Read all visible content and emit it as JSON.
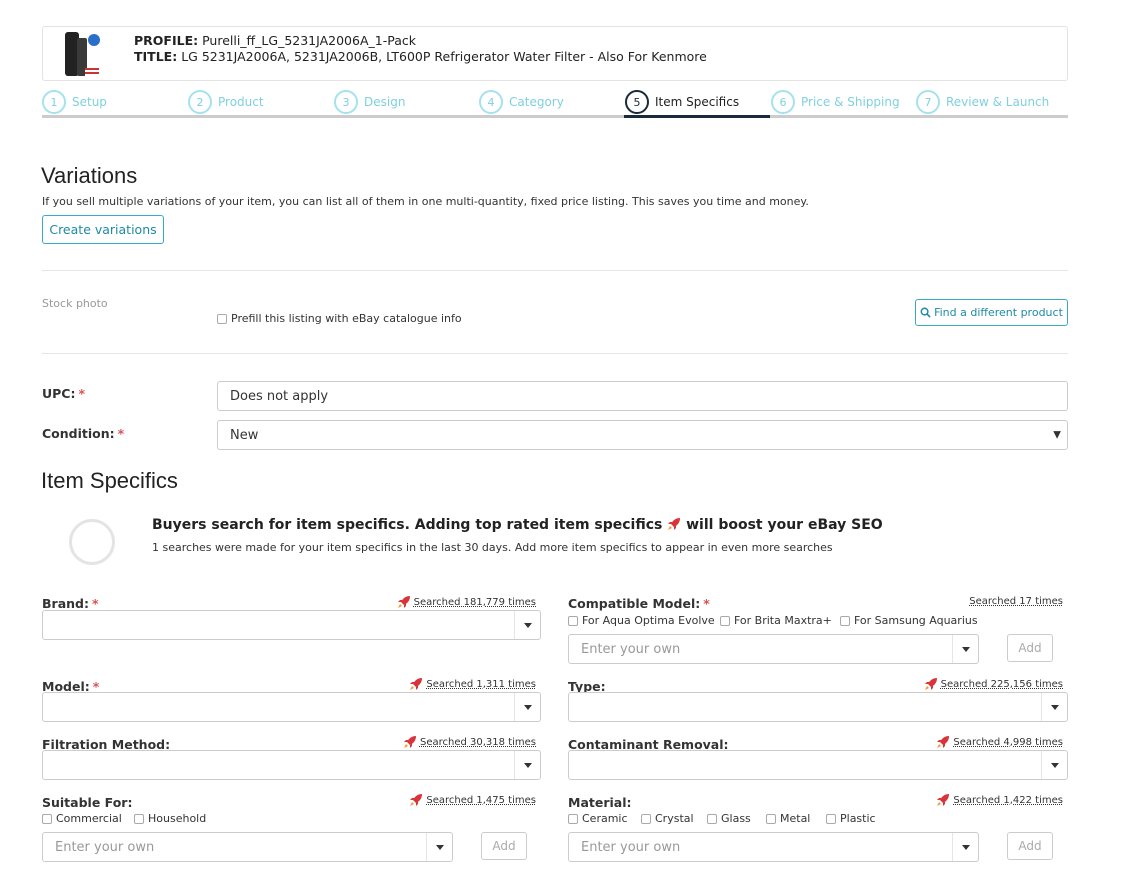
{
  "profile": {
    "profile_label": "PROFILE:",
    "profile_value": "Purelli_ff_LG_5231JA2006A_1-Pack",
    "title_label": "TITLE:",
    "title_value": "LG 5231JA2006A, 5231JA2006B, LT600P Refrigerator Water Filter - Also For Kenmore"
  },
  "steps": [
    {
      "num": "1",
      "label": "Setup"
    },
    {
      "num": "2",
      "label": "Product"
    },
    {
      "num": "3",
      "label": "Design"
    },
    {
      "num": "4",
      "label": "Category"
    },
    {
      "num": "5",
      "label": "Item Specifics",
      "active": true
    },
    {
      "num": "6",
      "label": "Price & Shipping"
    },
    {
      "num": "7",
      "label": "Review & Launch"
    }
  ],
  "variations": {
    "heading": "Variations",
    "description": "If you sell multiple variations of your item, you can list all of them in one multi-quantity, fixed price listing. This saves you time and money.",
    "button": "Create variations"
  },
  "stock": {
    "label": "Stock photo",
    "prefill_label": "Prefill this listing with eBay catalogue info",
    "find_button": "Find a different product"
  },
  "upc": {
    "label": "UPC:",
    "value": "Does not apply"
  },
  "condition": {
    "label": "Condition:",
    "value": "New"
  },
  "specifics": {
    "heading": "Item Specifics",
    "seo_title_a": "Buyers search for item specifics. Adding top rated item specifics",
    "seo_title_b": "will boost your eBay SEO",
    "seo_sub": "1 searches were made for your item specifics in the last 30 days. Add more item specifics to appear in even more searches"
  },
  "fields": {
    "brand": {
      "label": "Brand:",
      "searched": "Searched 181,779 times"
    },
    "compatible_model": {
      "label": "Compatible Model:",
      "searched": "Searched 17 times",
      "options": [
        "For Aqua Optima Evolve",
        "For Brita Maxtra+",
        "For Samsung Aquarius"
      ],
      "placeholder": "Enter your own",
      "add": "Add"
    },
    "model": {
      "label": "Model:",
      "searched": "Searched 1,311 times"
    },
    "type": {
      "label": "Type:",
      "searched": "Searched 225,156 times"
    },
    "filtration_method": {
      "label": "Filtration Method:",
      "searched": "Searched 30,318 times"
    },
    "contaminant_removal": {
      "label": "Contaminant Removal:",
      "searched": "Searched 4,998 times"
    },
    "suitable_for": {
      "label": "Suitable For:",
      "searched": "Searched 1,475 times",
      "options": [
        "Commercial",
        "Household"
      ],
      "placeholder": "Enter your own",
      "add": "Add"
    },
    "material": {
      "label": "Material:",
      "searched": "Searched 1,422 times",
      "options": [
        "Ceramic",
        "Crystal",
        "Glass",
        "Metal",
        "Plastic"
      ],
      "placeholder": "Enter your own",
      "add": "Add"
    }
  },
  "colors": {
    "accent": "#3aa9c3",
    "required": "#d9534f",
    "rocket": "#d9343a"
  }
}
